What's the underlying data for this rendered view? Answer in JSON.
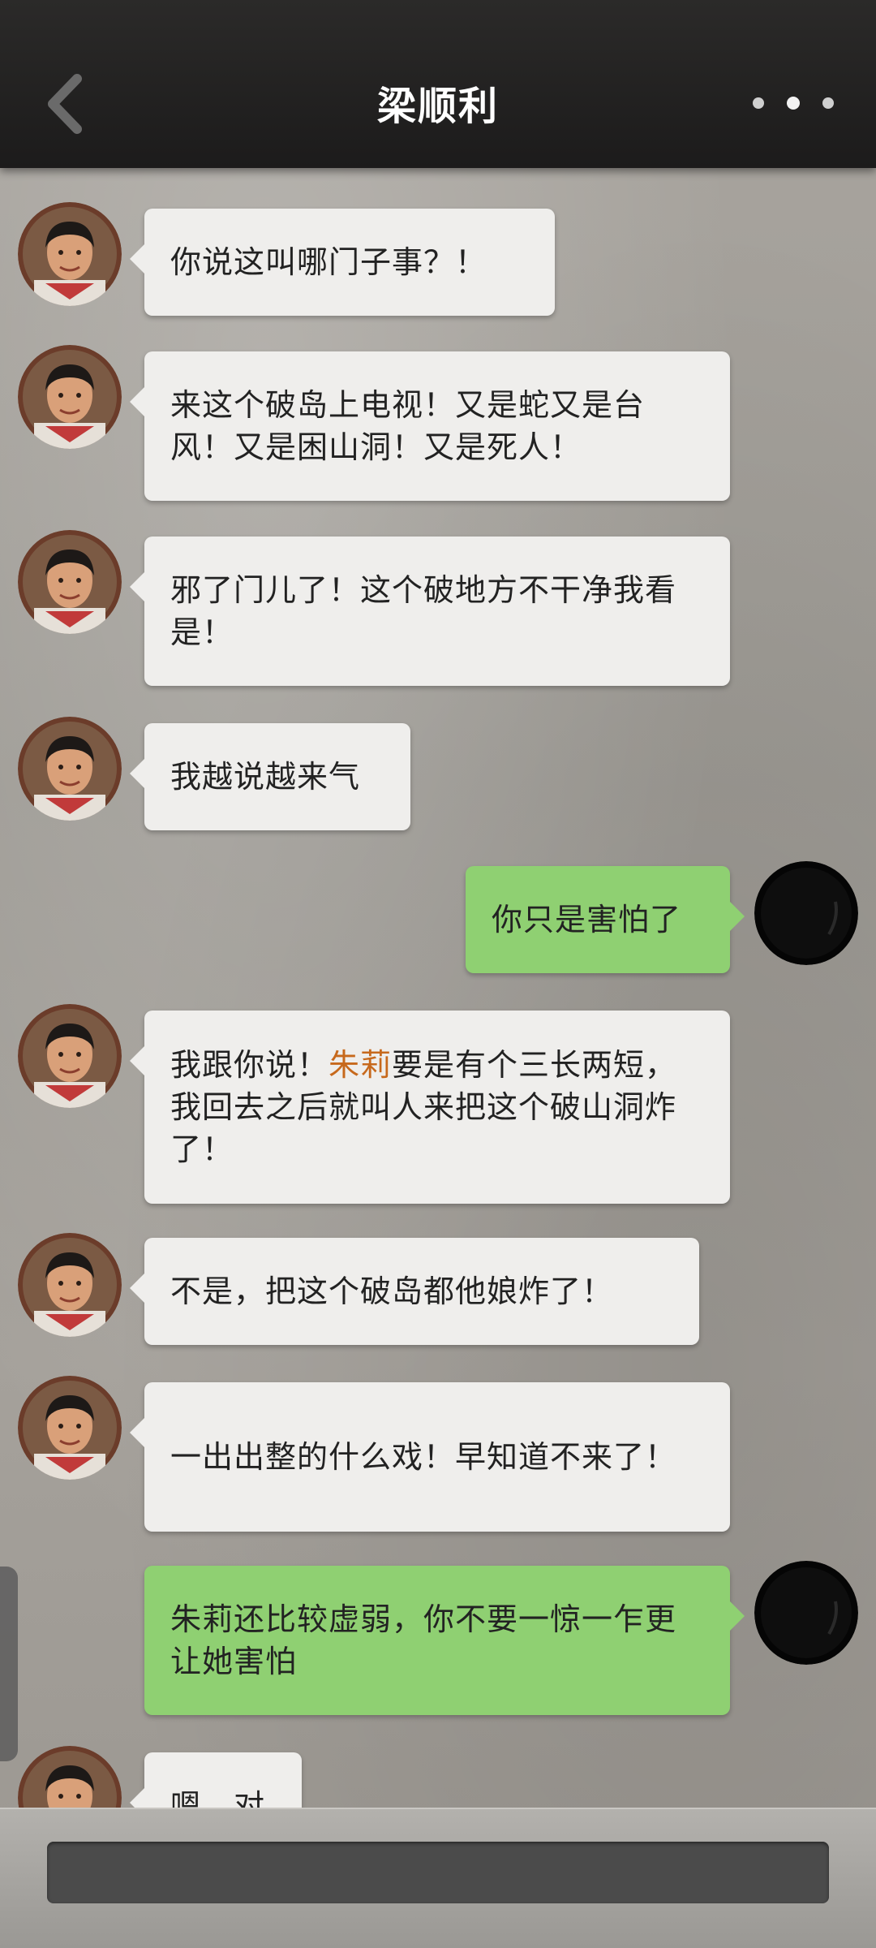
{
  "header": {
    "title": "梁顺利"
  },
  "messages": [
    {
      "side": "left",
      "text": "你说这叫哪门子事？！"
    },
    {
      "side": "left",
      "text": "来这个破岛上电视！又是蛇又是台风！又是困山洞！又是死人！"
    },
    {
      "side": "left",
      "text": "邪了门儿了！这个破地方不干净我看是！"
    },
    {
      "side": "left",
      "text": "我越说越来气"
    },
    {
      "side": "right",
      "text": "你只是害怕了"
    },
    {
      "side": "left",
      "prefix": "我跟你说！",
      "highlight": "朱莉",
      "suffix": "要是有个三长两短，我回去之后就叫人来把这个破山洞炸了！"
    },
    {
      "side": "left",
      "text": "不是，把这个破岛都他娘炸了！"
    },
    {
      "side": "left",
      "text": "一出出整的什么戏！早知道不来了！"
    },
    {
      "side": "right",
      "text": "朱莉还比较虚弱，你不要一惊一乍更让她害怕"
    },
    {
      "side": "left",
      "text": "嗯，对"
    }
  ],
  "colors": {
    "incoming_bubble": "#efeeec",
    "outgoing_bubble": "#8fd072",
    "highlight_name": "#c7691c",
    "header_bg": "#1c1b1b"
  },
  "icons": {
    "back": "chevron-left-icon",
    "more": "more-dots-icon"
  }
}
